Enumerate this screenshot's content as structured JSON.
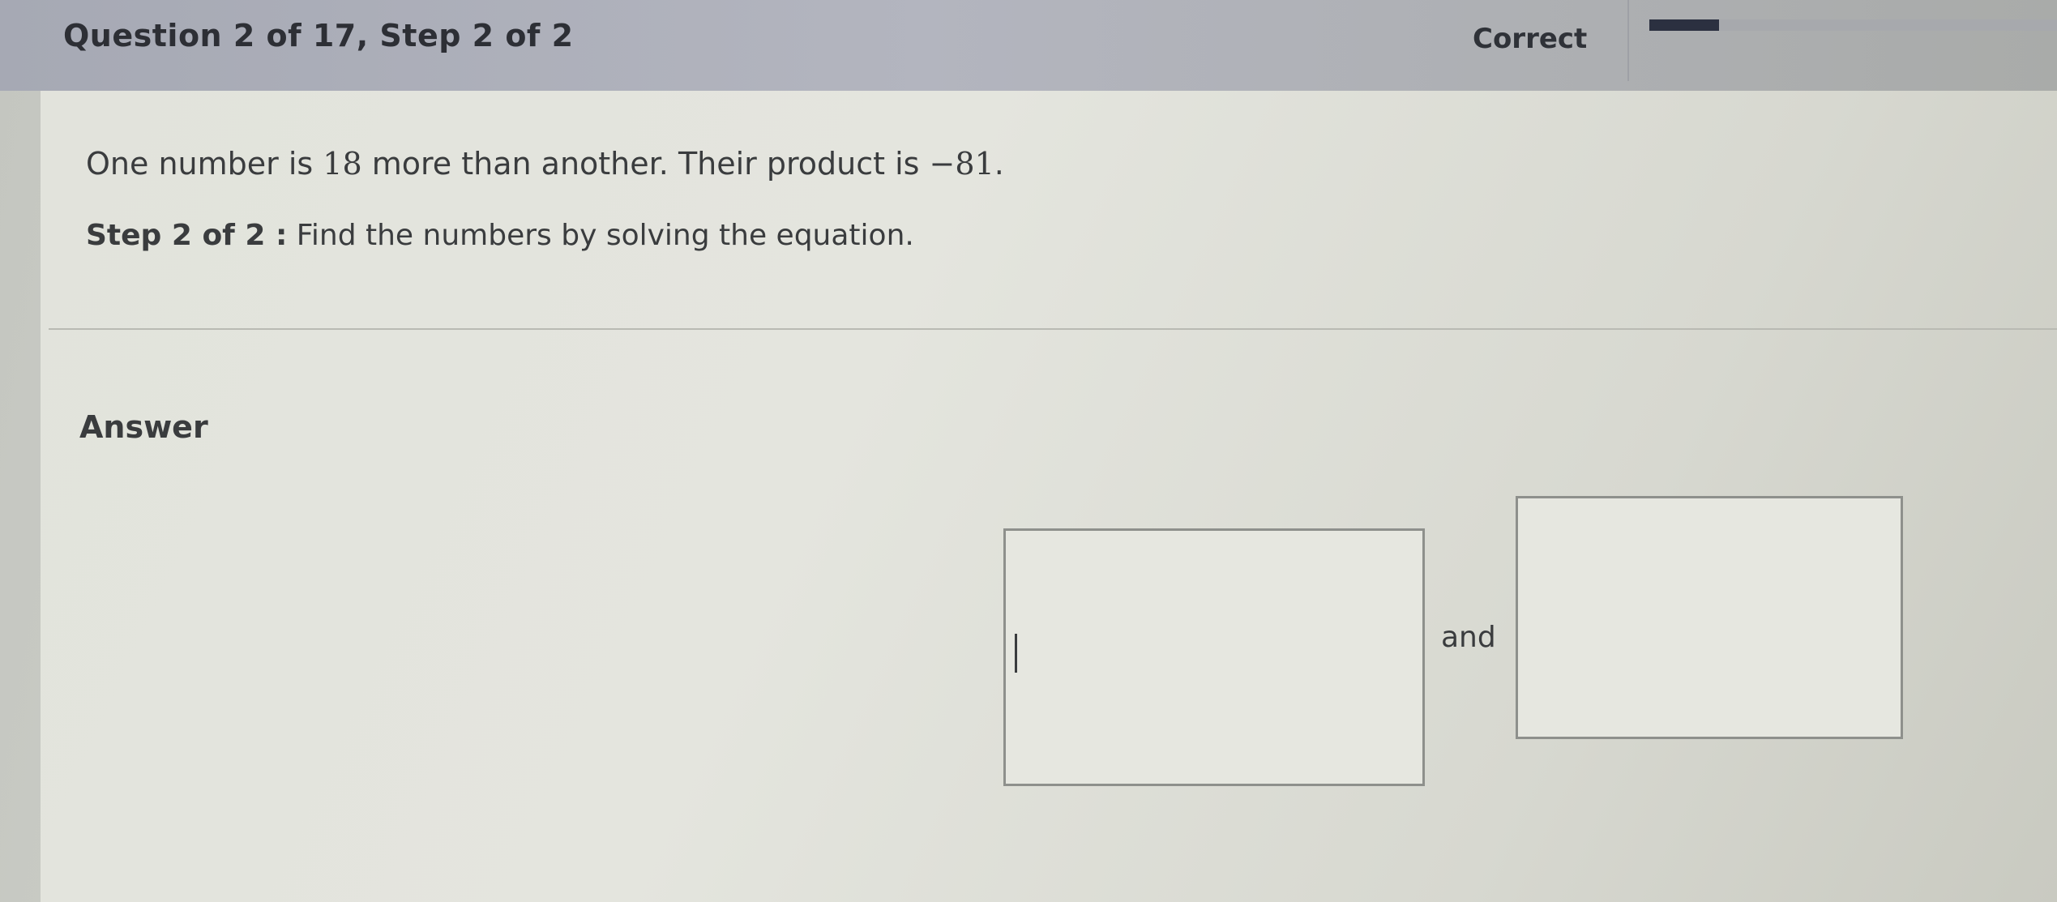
{
  "header": {
    "question_title": "Question 2 of 17, Step 2 of 2",
    "status": "Correct",
    "progress_fraction": 0.17
  },
  "problem": {
    "text_before": "One number is ",
    "number_a": "18",
    "text_middle": " more than another. Their product is ",
    "number_b": "−81",
    "text_after": "."
  },
  "step": {
    "label": "Step 2 of 2 :",
    "instruction": "Find the numbers by solving the equation."
  },
  "answer": {
    "heading": "Answer",
    "first_value": "",
    "joiner": "and",
    "second_value": ""
  }
}
